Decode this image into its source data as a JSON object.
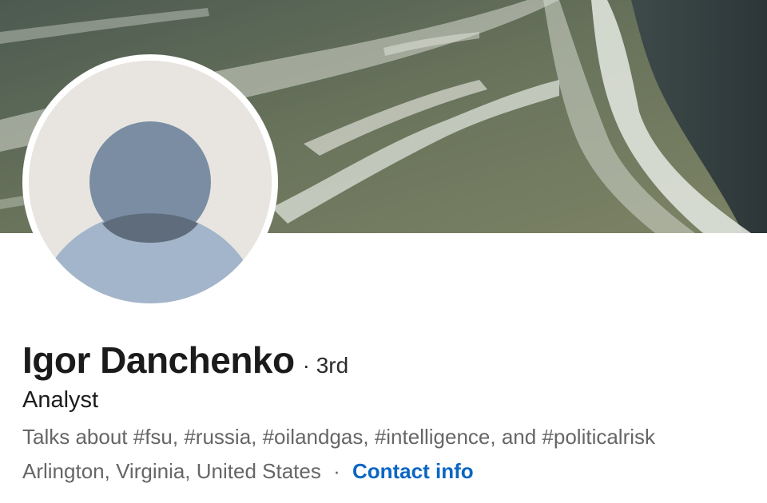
{
  "profile": {
    "name": "Igor Danchenko",
    "connection_degree": "· 3rd",
    "headline": "Analyst",
    "talks_about": "Talks about #fsu, #russia, #oilandgas, #intelligence, and #politicalrisk",
    "location": "Arlington, Virginia, United States",
    "location_separator": "·",
    "contact_info_label": "Contact info"
  },
  "colors": {
    "link": "#0a66c2",
    "secondary_text": "#666666",
    "avatar_bg": "#e8e5e1",
    "avatar_head": "#7a8da3",
    "avatar_body": "#a3b5ca"
  },
  "icons": {
    "avatar": "default-person-avatar-icon"
  }
}
